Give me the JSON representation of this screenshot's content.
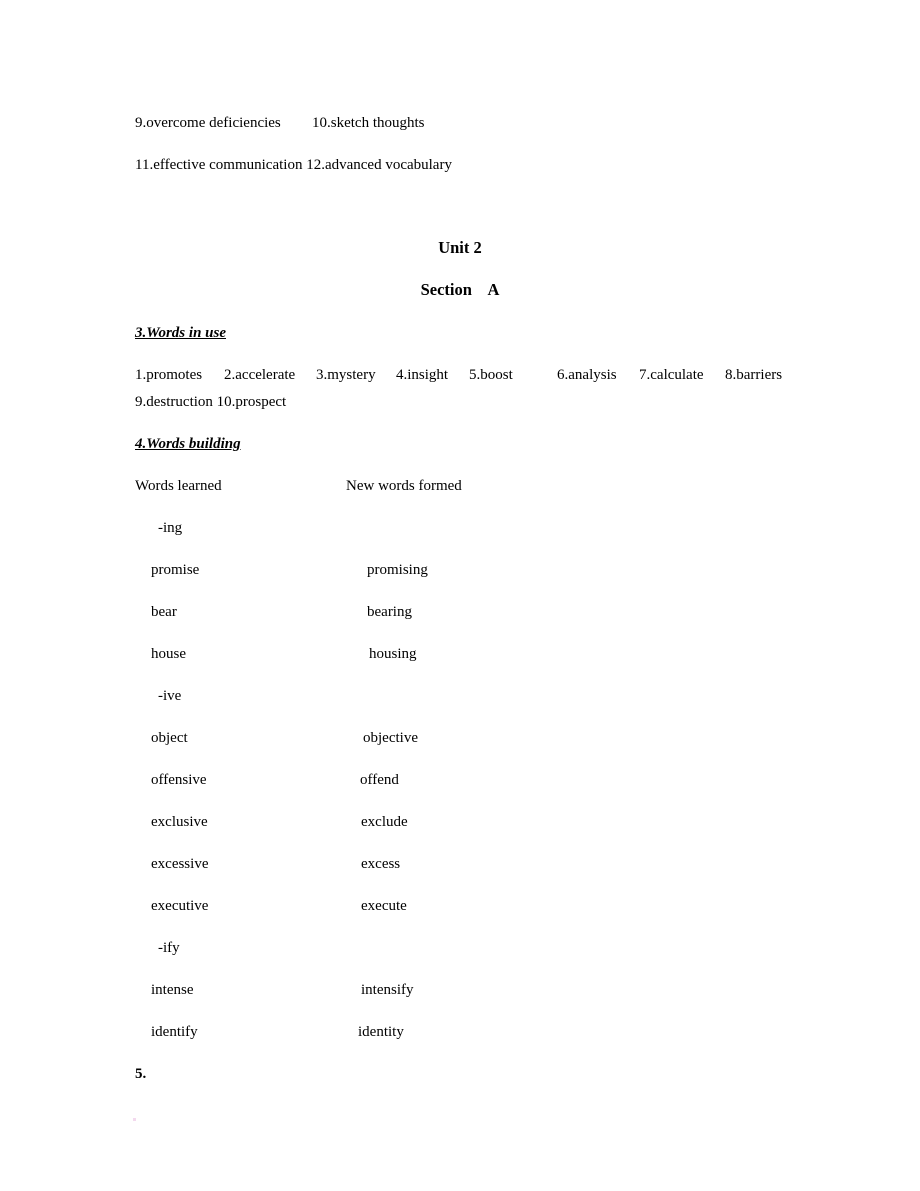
{
  "prev_answers": {
    "line1": [
      "9.overcome deficiencies",
      "10.sketch thoughts"
    ],
    "line2": "11.effective communication 12.advanced vocabulary"
  },
  "unit_title": "Unit 2",
  "section_title": "Section    A",
  "words_in_use": {
    "heading": "3.Words in use",
    "answers": [
      "1.promotes",
      "2.accelerate",
      "3.mystery",
      "4.insight",
      "5.boost",
      "6.analysis",
      "7.calculate",
      "8.barriers"
    ],
    "answers_line2": "9.destruction 10.prospect"
  },
  "words_building": {
    "heading": "4.Words building",
    "col_learned": "Words learned",
    "col_formed": "New words formed",
    "groups": [
      {
        "suffix": "-ing",
        "rows": [
          {
            "learned": "promise",
            "formed": "promising"
          },
          {
            "learned": "bear",
            "formed": "bearing"
          },
          {
            "learned": "house",
            "formed": "housing"
          }
        ]
      },
      {
        "suffix": "-ive",
        "rows": [
          {
            "learned": "object",
            "formed": "objective"
          },
          {
            "learned": "offensive",
            "formed": "offend"
          },
          {
            "learned": "exclusive",
            "formed": "exclude"
          },
          {
            "learned": "excessive",
            "formed": "excess"
          },
          {
            "learned": "executive",
            "formed": "execute"
          }
        ]
      },
      {
        "suffix": "-ify",
        "rows": [
          {
            "learned": "intense",
            "formed": "intensify"
          },
          {
            "learned": "identify",
            "formed": "identity"
          }
        ]
      }
    ]
  },
  "next_item": "5."
}
